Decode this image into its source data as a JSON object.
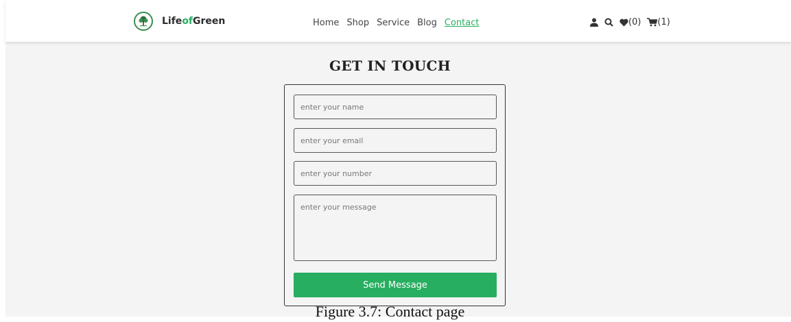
{
  "brand": {
    "prefix": "Life",
    "accent": "of",
    "suffix": "Green",
    "accent_color": "#27ae60"
  },
  "nav": {
    "home": "Home",
    "shop": "Shop",
    "service": "Service",
    "blog": "Blog",
    "contact": "Contact",
    "active": "Contact"
  },
  "header_icons": {
    "user_icon": "user-icon",
    "search_icon": "search-icon",
    "wishlist_count": "(0)",
    "cart_count": "(1)"
  },
  "contact": {
    "title": "GET IN TOUCH",
    "name_placeholder": "enter your name",
    "email_placeholder": "enter your email",
    "number_placeholder": "enter your number",
    "message_placeholder": "enter your message",
    "send_label": "Send Message",
    "button_color": "#27ae60"
  },
  "caption": "Figure 3.7: Contact page"
}
